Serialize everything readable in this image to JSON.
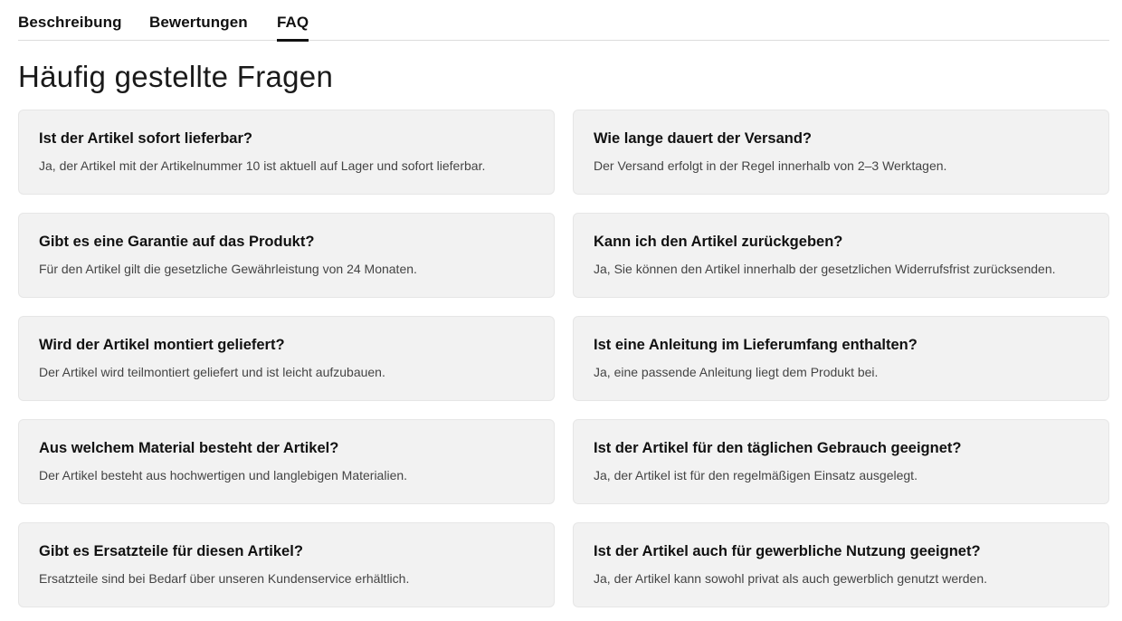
{
  "tabs": [
    {
      "label": "Beschreibung",
      "active": false
    },
    {
      "label": "Bewertungen",
      "active": false
    },
    {
      "label": "FAQ",
      "active": true
    }
  ],
  "faq": {
    "title": "Häufig gestellte Fragen",
    "items": [
      {
        "question": "Ist der Artikel sofort lieferbar?",
        "answer": "Ja, der Artikel mit der Artikelnummer 10 ist aktuell auf Lager und sofort lieferbar."
      },
      {
        "question": "Wie lange dauert der Versand?",
        "answer": "Der Versand erfolgt in der Regel innerhalb von 2–3 Werktagen."
      },
      {
        "question": "Gibt es eine Garantie auf das Produkt?",
        "answer": "Für den Artikel gilt die gesetzliche Gewährleistung von 24 Monaten."
      },
      {
        "question": "Kann ich den Artikel zurückgeben?",
        "answer": "Ja, Sie können den Artikel innerhalb der gesetzlichen Widerrufsfrist zurücksenden."
      },
      {
        "question": "Wird der Artikel montiert geliefert?",
        "answer": "Der Artikel wird teilmontiert geliefert und ist leicht aufzubauen."
      },
      {
        "question": "Ist eine Anleitung im Lieferumfang enthalten?",
        "answer": "Ja, eine passende Anleitung liegt dem Produkt bei."
      },
      {
        "question": "Aus welchem Material besteht der Artikel?",
        "answer": "Der Artikel besteht aus hochwertigen und langlebigen Materialien."
      },
      {
        "question": "Ist der Artikel für den täglichen Gebrauch geeignet?",
        "answer": "Ja, der Artikel ist für den regelmäßigen Einsatz ausgelegt."
      },
      {
        "question": "Gibt es Ersatzteile für diesen Artikel?",
        "answer": "Ersatzteile sind bei Bedarf über unseren Kundenservice erhältlich."
      },
      {
        "question": "Ist der Artikel auch für gewerbliche Nutzung geeignet?",
        "answer": "Ja, der Artikel kann sowohl privat als auch gewerblich genutzt werden."
      }
    ]
  }
}
